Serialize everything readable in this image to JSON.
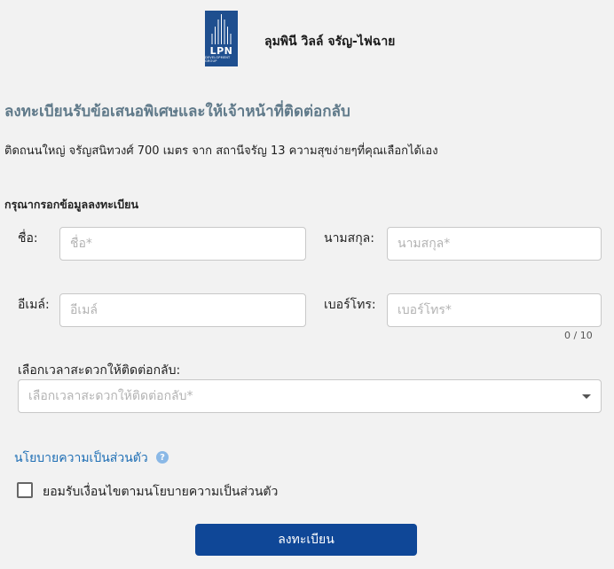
{
  "header": {
    "logo_text": "LPN",
    "logo_subtext": "DEVELOPMENT GROUP",
    "project_name": "ลุมพินี วิลล์ จรัญ-ไฟฉาย"
  },
  "title": "ลงทะเบียนรับข้อเสนอพิเศษและให้เจ้าหน้าที่ติดต่อกลับ",
  "subtitle": "ติดถนนใหญ่ จรัญสนิทวงศ์ 700 เมตร จาก สถานีจรัญ 13 ความสุขง่ายๆที่คุณเลือกได้เอง",
  "form": {
    "section_label": "กรุณากรอกข้อมูลลงทะเบียน",
    "first_name": {
      "label": "ชื่อ:",
      "placeholder": "ชื่อ*",
      "value": ""
    },
    "last_name": {
      "label": "นามสกุล:",
      "placeholder": "นามสกุล*",
      "value": ""
    },
    "email": {
      "label": "อีเมล์:",
      "placeholder": "อีเมล์",
      "value": ""
    },
    "phone": {
      "label": "เบอร์โทร:",
      "placeholder": "เบอร์โทร*",
      "value": "",
      "counter": "0 / 10"
    },
    "contact_time": {
      "label": "เลือกเวลาสะดวกให้ติดต่อกลับ:",
      "placeholder": "เลือกเวลาสะดวกให้ติดต่อกลับ*"
    },
    "privacy_link": "นโยบายความเป็นส่วนตัว",
    "help_icon": "?",
    "consent_label": "ยอมรับเงื่อนไขตามนโยบายความเป็นส่วนตัว",
    "consent_checked": false,
    "submit_label": "ลงทะเบียน"
  },
  "colors": {
    "title": "#607a8a",
    "link": "#1f6fb5",
    "button": "#0f4797",
    "logo_bg": "#1f4f8f"
  }
}
